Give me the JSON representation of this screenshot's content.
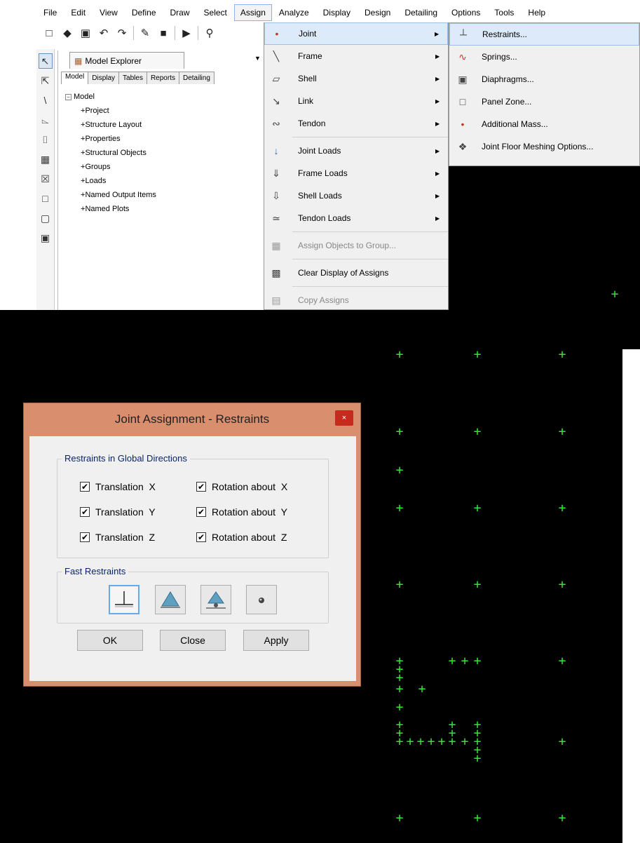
{
  "menubar": {
    "items": [
      "File",
      "Edit",
      "View",
      "Define",
      "Draw",
      "Select",
      "Assign",
      "Analyze",
      "Display",
      "Design",
      "Detailing",
      "Options",
      "Tools",
      "Help"
    ]
  },
  "explorer": {
    "title": "Model Explorer",
    "tabs": [
      "Model",
      "Display",
      "Tables",
      "Reports",
      "Detailing"
    ],
    "tree_root": "Model",
    "tree_children": [
      "Project",
      "Structure Layout",
      "Properties",
      "Structural Objects",
      "Groups",
      "Loads",
      "Named Output Items",
      "Named Plots"
    ]
  },
  "assign_menu": {
    "items": [
      {
        "label": "Joint",
        "icon": "joint-icon",
        "submenu": true,
        "highlighted": true
      },
      {
        "label": "Frame",
        "icon": "frame-icon",
        "submenu": true
      },
      {
        "label": "Shell",
        "icon": "shell-icon",
        "submenu": true
      },
      {
        "label": "Link",
        "icon": "link-icon",
        "submenu": true
      },
      {
        "label": "Tendon",
        "icon": "tendon-icon",
        "submenu": true
      },
      {
        "label": "Joint Loads",
        "icon": "joint-loads-icon",
        "submenu": true
      },
      {
        "label": "Frame Loads",
        "icon": "frame-loads-icon",
        "submenu": true
      },
      {
        "label": "Shell Loads",
        "icon": "shell-loads-icon",
        "submenu": true
      },
      {
        "label": "Tendon Loads",
        "icon": "tendon-loads-icon",
        "submenu": true
      },
      {
        "label": "Assign Objects to Group...",
        "icon": "group-icon",
        "disabled": true
      },
      {
        "label": "Clear Display of Assigns",
        "icon": "clear-display-icon"
      },
      {
        "label": "Copy Assigns",
        "icon": "copy-assigns-icon",
        "disabled": true
      }
    ]
  },
  "joint_submenu": {
    "items": [
      {
        "label": "Restraints...",
        "icon": "restraints-icon",
        "highlighted": true
      },
      {
        "label": "Springs...",
        "icon": "springs-icon"
      },
      {
        "label": "Diaphragms...",
        "icon": "diaphragms-icon"
      },
      {
        "label": "Panel Zone...",
        "icon": "panel-zone-icon"
      },
      {
        "label": "Additional Mass...",
        "icon": "additional-mass-icon"
      },
      {
        "label": "Joint Floor Meshing Options...",
        "icon": "meshing-options-icon"
      }
    ]
  },
  "dialog": {
    "title": "Joint Assignment - Restraints",
    "close_glyph": "×",
    "group_global": "Restraints in Global Directions",
    "checkboxes": [
      {
        "label": "Translation  X",
        "checked": true
      },
      {
        "label": "Translation  Y",
        "checked": true
      },
      {
        "label": "Translation  Z",
        "checked": true
      },
      {
        "label": "Rotation about  X",
        "checked": true
      },
      {
        "label": "Rotation about  Y",
        "checked": true
      },
      {
        "label": "Rotation about  Z",
        "checked": true
      }
    ],
    "group_fast": "Fast Restraints",
    "fast_buttons": [
      "fixed-support-icon",
      "pinned-support-icon",
      "roller-support-icon",
      "free-joint-icon"
    ],
    "ok_label": "OK",
    "close_label": "Close",
    "apply_label": "Apply"
  },
  "colors": {
    "joint_marker": "#2fe82f",
    "canvas_bg": "#000000",
    "dialog_frame": "#d98e6e",
    "highlight": "#dceaf9",
    "group_title": "#0a246a"
  }
}
